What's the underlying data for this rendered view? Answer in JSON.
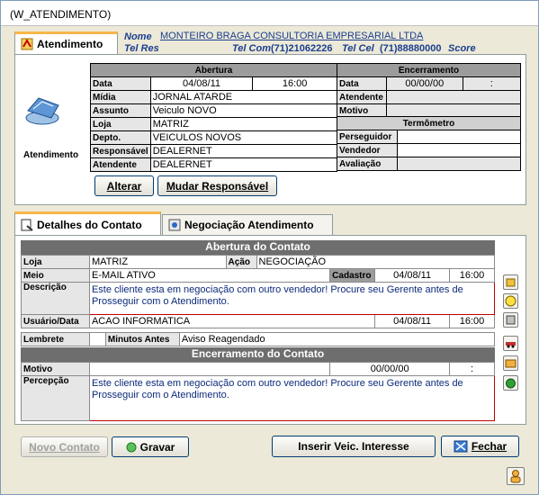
{
  "window": {
    "title": "(W_ATENDIMENTO)"
  },
  "tabs_top": {
    "active": "Atendimento"
  },
  "header": {
    "nome_label": "Nome",
    "nome_value": "MONTEIRO BRAGA CONSULTORIA EMPRESARIAL LTDA",
    "telres_label": "Tel Res",
    "telcom_label": "Tel Com",
    "telcom_value": "(71)21062226",
    "telcel_label": "Tel Cel",
    "telcel_value": "(71)88880000",
    "score_label": "Score"
  },
  "atendimento": {
    "icon_label": "Atendimento",
    "abertura_title": "Abertura",
    "encerramento_title": "Encerramento",
    "data_label": "Data",
    "data_value": "04/08/11",
    "hora_value": "16:00",
    "midia_label": "Mídia",
    "midia_value": "JORNAL ATARDE",
    "assunto_label": "Assunto",
    "assunto_value": "Veiculo NOVO",
    "loja_label": "Loja",
    "loja_value": "MATRIZ",
    "depto_label": "Depto.",
    "depto_value": "VEICULOS NOVOS",
    "responsavel_label": "Responsável",
    "responsavel_value": "DEALERNET",
    "atendente_label": "Atendente",
    "atendente_value": "DEALERNET",
    "enc_data_label": "Data",
    "enc_data_value": "00/00/00",
    "enc_hora_value": ":",
    "enc_atendente_label": "Atendente",
    "enc_motivo_label": "Motivo",
    "termometro_title": "Termômetro",
    "perseguidor_label": "Perseguidor",
    "vendedor_label": "Vendedor",
    "avaliacao_label": "Avaliação"
  },
  "buttons_top": {
    "alterar": "Alterar",
    "mudar": "Mudar Responsável"
  },
  "tabs_bottom": {
    "detalhes": "Detalhes do Contato",
    "negociacao": "Negociação Atendimento"
  },
  "contato": {
    "abertura_title": "Abertura do Contato",
    "loja_label": "Loja",
    "loja_value": "MATRIZ",
    "acao_label": "Ação",
    "acao_value": "NEGOCIAÇÃO",
    "meio_label": "Meio",
    "meio_value": "E-MAIL ATIVO",
    "cadastro_label": "Cadastro",
    "cadastro_data": "04/08/11",
    "cadastro_hora": "16:00",
    "descricao_label": "Descrição",
    "descricao_value": "Este cliente esta em negociação com outro vendedor! Procure seu Gerente antes de Prosseguir com o Atendimento.",
    "usuario_label": "Usuário/Data",
    "usuario_value": "ACAO INFORMATICA",
    "usuario_data": "04/08/11",
    "usuario_hora": "16:00",
    "lembrete_label": "Lembrete",
    "minutos_label": "Minutos Antes",
    "minutos_value": "Aviso Reagendado",
    "encerramento_title": "Encerramento do Contato",
    "motivo_label": "Motivo",
    "motivo_data": "00/00/00",
    "motivo_hora": ":",
    "percepcao_label": "Percepção",
    "percepcao_value": "Este cliente esta em negociação com outro vendedor! Procure seu Gerente antes de Prosseguir com o Atendimento."
  },
  "buttons_bottom": {
    "novo": "Novo Contato",
    "gravar": "Gravar",
    "inserir": "Inserir Veic. Interesse",
    "fechar": "Fechar"
  }
}
